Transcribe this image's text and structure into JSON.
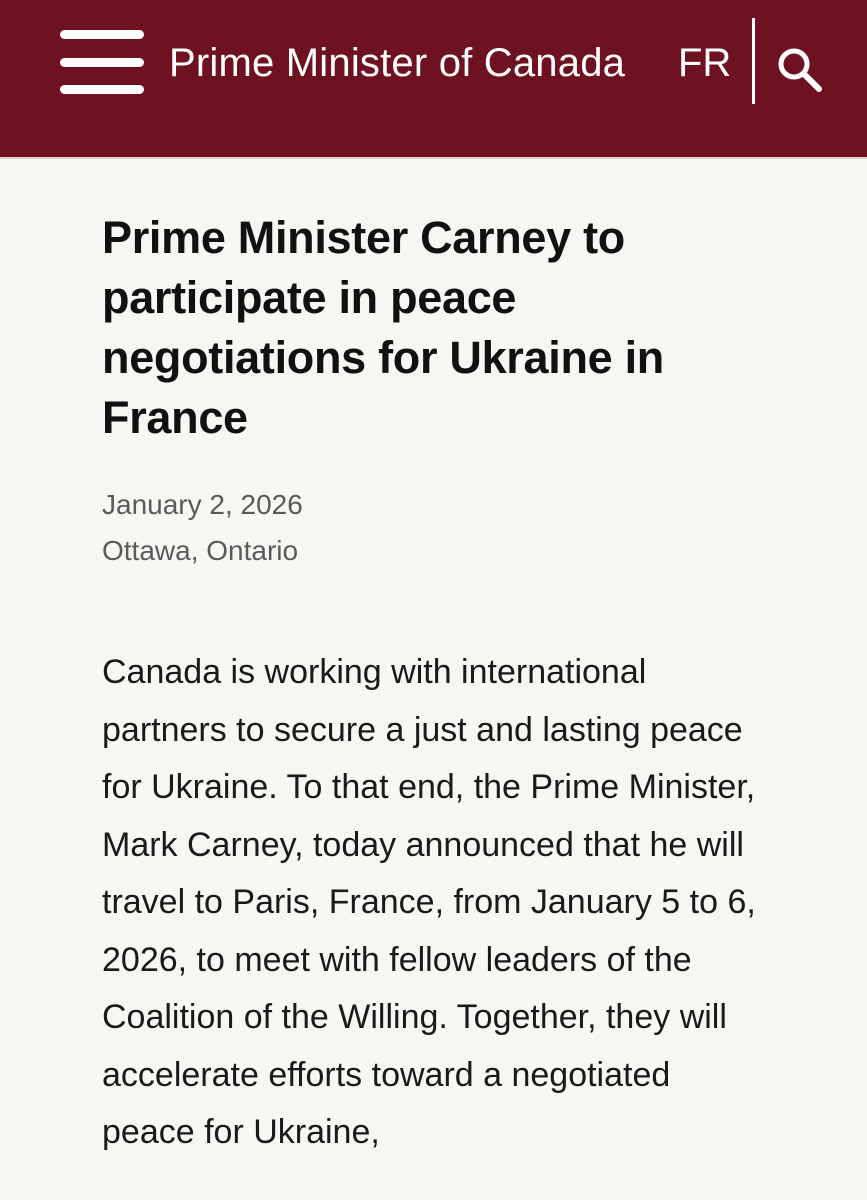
{
  "header": {
    "site_title": "Prime Minister of Canada",
    "language_toggle": "FR",
    "menu_icon": "hamburger-menu-icon",
    "search_icon": "search-icon",
    "background_color": "#6e1120"
  },
  "article": {
    "title": "Prime Minister Carney to participate in peace negotiations for Ukraine in France",
    "date": "January 2, 2026",
    "location": "Ottawa, Ontario",
    "body": "Canada is working with international partners to secure a just and lasting peace for Ukraine. To that end, the Prime Minister, Mark Carney, today announced that he will travel to Paris, France, from January 5 to 6, 2026, to meet with fellow leaders of the Coalition of the Willing. Together, they will accelerate efforts toward a negotiated peace for Ukraine,"
  }
}
